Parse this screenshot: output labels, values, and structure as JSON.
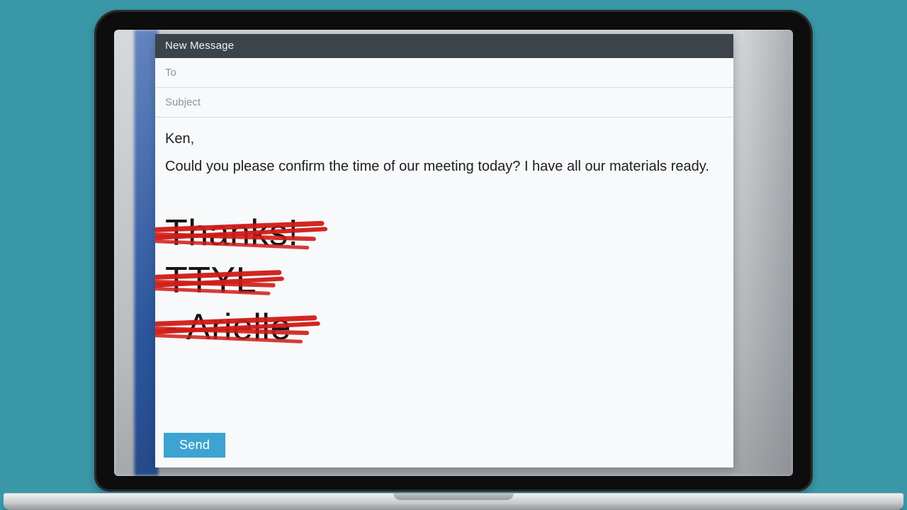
{
  "compose": {
    "title": "New Message",
    "to": {
      "placeholder": "To",
      "value": ""
    },
    "subject": {
      "placeholder": "Subject",
      "value": ""
    },
    "body": {
      "greeting": "Ken,",
      "paragraph": "Could you please confirm the time of our meeting today? I have all our materials ready.",
      "signoff_struck": [
        "Thanks!",
        "TTYL",
        "- Arielle"
      ]
    },
    "send_label": "Send"
  },
  "colors": {
    "page_bg": "#3a97a8",
    "titlebar_bg": "#3c434a",
    "send_bg": "#3da3d1",
    "strike_red": "#d11b16"
  }
}
